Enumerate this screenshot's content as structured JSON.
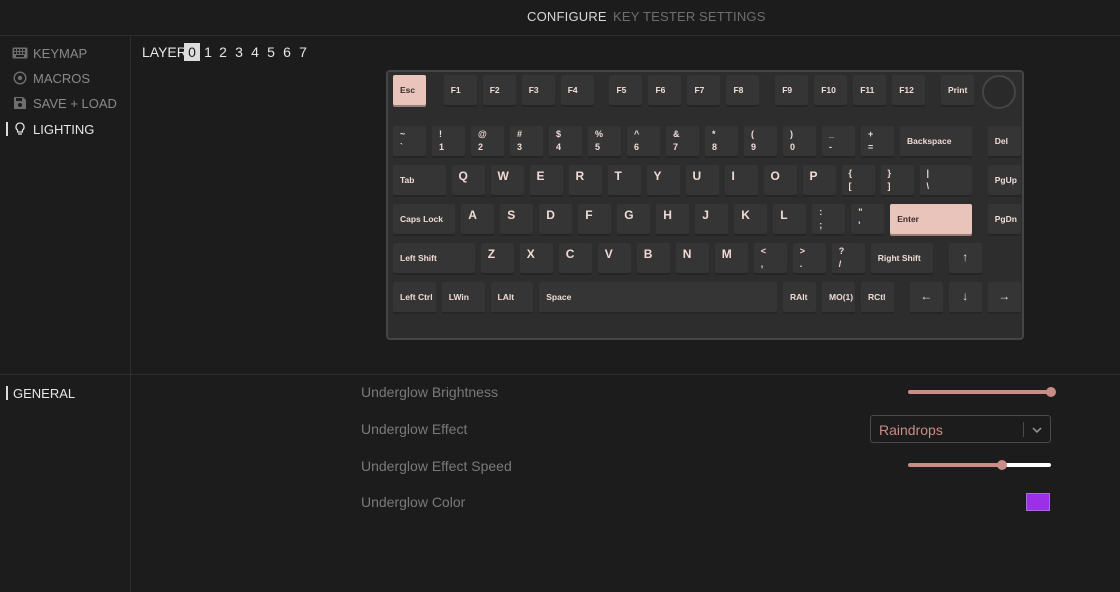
{
  "top_nav": {
    "tabs": [
      {
        "label": "CONFIGURE",
        "active": true
      },
      {
        "label": "KEY TESTER",
        "active": false
      },
      {
        "label": "SETTINGS",
        "active": false
      }
    ]
  },
  "sidebar": {
    "items": [
      {
        "label": "KEYMAP",
        "icon": "keyboard-icon",
        "active": false
      },
      {
        "label": "MACROS",
        "icon": "macro-circle-icon",
        "active": false
      },
      {
        "label": "SAVE + LOAD",
        "icon": "floppy-disk-icon",
        "active": false
      },
      {
        "label": "LIGHTING",
        "icon": "lightbulb-icon",
        "active": true
      }
    ]
  },
  "layers": {
    "label": "LAYER",
    "items": [
      "0",
      "1",
      "2",
      "3",
      "4",
      "5",
      "6",
      "7"
    ],
    "selected": "0"
  },
  "keyboard": {
    "accent_color": "#e8c4bb",
    "keys": [
      {
        "label": "Esc",
        "accent": true
      },
      {
        "label": "F1"
      },
      {
        "label": "F2"
      },
      {
        "label": "F3"
      },
      {
        "label": "F4"
      },
      {
        "label": "F5"
      },
      {
        "label": "F6"
      },
      {
        "label": "F7"
      },
      {
        "label": "F8"
      },
      {
        "label": "F9"
      },
      {
        "label": "F10"
      },
      {
        "label": "F11"
      },
      {
        "label": "F12"
      },
      {
        "label": "Print"
      },
      {
        "shift": "~",
        "base": "`"
      },
      {
        "shift": "!",
        "base": "1"
      },
      {
        "shift": "@",
        "base": "2"
      },
      {
        "shift": "#",
        "base": "3"
      },
      {
        "shift": "$",
        "base": "4"
      },
      {
        "shift": "%",
        "base": "5"
      },
      {
        "shift": "^",
        "base": "6"
      },
      {
        "shift": "&",
        "base": "7"
      },
      {
        "shift": "*",
        "base": "8"
      },
      {
        "shift": "(",
        "base": "9"
      },
      {
        "shift": ")",
        "base": "0"
      },
      {
        "shift": "_",
        "base": "-"
      },
      {
        "shift": "+",
        "base": "="
      },
      {
        "label": "Backspace"
      },
      {
        "label": "Del"
      },
      {
        "label": "Tab"
      },
      {
        "letter": "Q"
      },
      {
        "letter": "W"
      },
      {
        "letter": "E"
      },
      {
        "letter": "R"
      },
      {
        "letter": "T"
      },
      {
        "letter": "Y"
      },
      {
        "letter": "U"
      },
      {
        "letter": "I"
      },
      {
        "letter": "O"
      },
      {
        "letter": "P"
      },
      {
        "shift": "{",
        "base": "["
      },
      {
        "shift": "}",
        "base": "]"
      },
      {
        "shift": "|",
        "base": "\\"
      },
      {
        "label": "PgUp"
      },
      {
        "label": "Caps Lock"
      },
      {
        "letter": "A"
      },
      {
        "letter": "S"
      },
      {
        "letter": "D"
      },
      {
        "letter": "F"
      },
      {
        "letter": "G"
      },
      {
        "letter": "H"
      },
      {
        "letter": "J"
      },
      {
        "letter": "K"
      },
      {
        "letter": "L"
      },
      {
        "shift": ":",
        "base": ";"
      },
      {
        "shift": "\"",
        "base": "'"
      },
      {
        "label": "Enter",
        "accent": true
      },
      {
        "label": "PgDn"
      },
      {
        "label": "Left Shift"
      },
      {
        "letter": "Z"
      },
      {
        "letter": "X"
      },
      {
        "letter": "C"
      },
      {
        "letter": "V"
      },
      {
        "letter": "B"
      },
      {
        "letter": "N"
      },
      {
        "letter": "M"
      },
      {
        "shift": "<",
        "base": ","
      },
      {
        "shift": ">",
        "base": "."
      },
      {
        "shift": "?",
        "base": "/"
      },
      {
        "label": "Right Shift"
      },
      {
        "arrow": "↑"
      },
      {
        "label": "Left Ctrl"
      },
      {
        "label": "LWin"
      },
      {
        "label": "LAlt"
      },
      {
        "label": "Space"
      },
      {
        "label": "RAlt"
      },
      {
        "label": "MO(1)"
      },
      {
        "label": "RCtl"
      },
      {
        "arrow": "←"
      },
      {
        "arrow": "↓"
      },
      {
        "arrow": "→"
      }
    ]
  },
  "general_section": {
    "label": "GENERAL"
  },
  "settings": {
    "brightness": {
      "label": "Underglow Brightness",
      "value": 1.0
    },
    "effect": {
      "label": "Underglow Effect",
      "value": "Raindrops"
    },
    "speed": {
      "label": "Underglow Effect Speed",
      "value": 0.66
    },
    "color": {
      "label": "Underglow Color",
      "value": "#9b30e8"
    },
    "slider_fill_color": "#c98c86",
    "slider_track_color": "#ffffff"
  }
}
